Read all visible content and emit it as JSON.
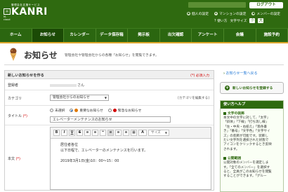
{
  "header": {
    "brand_sub": "管理会社支援サービス",
    "brand_name": "KANRI",
    "brand_mark": "M",
    "brand_cloud": "M-cloud",
    "logout_label": "ログアウト",
    "links": [
      {
        "label": "個人の設定",
        "icon": "user-icon"
      },
      {
        "label": "マンションの設定",
        "icon": "building-icon"
      },
      {
        "label": "メンバーの設定",
        "icon": "members-icon"
      }
    ],
    "help_label": "使い方",
    "font_size_label": "文字サイズ",
    "font_small": "小",
    "font_large": "大"
  },
  "nav": {
    "items": [
      {
        "label": "ホーム"
      },
      {
        "label": "お知らせ"
      },
      {
        "label": "カレンダー"
      },
      {
        "label": "データ保存箱"
      },
      {
        "label": "掲示板"
      },
      {
        "label": "出欠確認"
      },
      {
        "label": "アンケート"
      },
      {
        "label": "会議"
      },
      {
        "label": "施設予約"
      }
    ],
    "active_index": 1
  },
  "page": {
    "title": "お知らせ",
    "description": "管理会社や管理会社からの各種「お知らせ」を閲覧できます。"
  },
  "form": {
    "heading": "新しいお知らせを作る",
    "required_note": "(*) 必須入力",
    "registrant_label": "登録者",
    "registrant_value": "さん",
    "category_label": "カテゴリ",
    "category_value": "管理会社からのお知らせ",
    "category_edit": "[カテゴリを編集する]",
    "title_label": "タイトル",
    "title_required": "(*)",
    "importance": [
      {
        "label": "未選択",
        "selected": false,
        "color": ""
      },
      {
        "label": "重要なお知らせ",
        "selected": true,
        "color": "#e07800"
      },
      {
        "label": "緊急なお知らせ",
        "selected": false,
        "color": "#d20000"
      }
    ],
    "title_value": "エレベーターメンテナンスのお知らせ",
    "body_label": "本文",
    "body_required": "(*)",
    "toolbar": {
      "buttons": [
        "B",
        "I",
        "U",
        "S",
        "≡",
        "≡",
        "❝",
        "≡",
        "≡",
        "≡",
        "▦",
        "A"
      ],
      "size_placeholder": "サイズ"
    },
    "body_lines": [
      "居住者各位",
      "以下日程で、エレベーターのメンテナンスを行います。",
      "",
      "2019年3月1日(金)10：00～15：00"
    ]
  },
  "sidebar": {
    "back_link": "お知らせ一覧へ戻る",
    "register_button": "新しいお知らせを登録する",
    "help_title": "使い方ヘルプ",
    "help_sections": [
      {
        "title": "文字の装飾",
        "lines": [
          "本文中の文字に対して、「太字」",
          "「斜体」「下線」「打ち消し線」",
          "「左・中央・右揃え」「箇条書",
          "き」「番号」「文字色」「文字サイ",
          "ズ」の装飾が可能です。装飾し",
          "たい文字列を選択された状態で",
          "アイコンをクリックするとき反映",
          "されます。"
        ]
      },
      {
        "title": "公開範囲",
        "lines": [
          "公開対象のメンバーを選定しま",
          "す。「全てのメンバー」を選択す",
          "ると、全員がこのお知らせを閲覧",
          "することができます。「グルー"
        ]
      }
    ]
  }
}
